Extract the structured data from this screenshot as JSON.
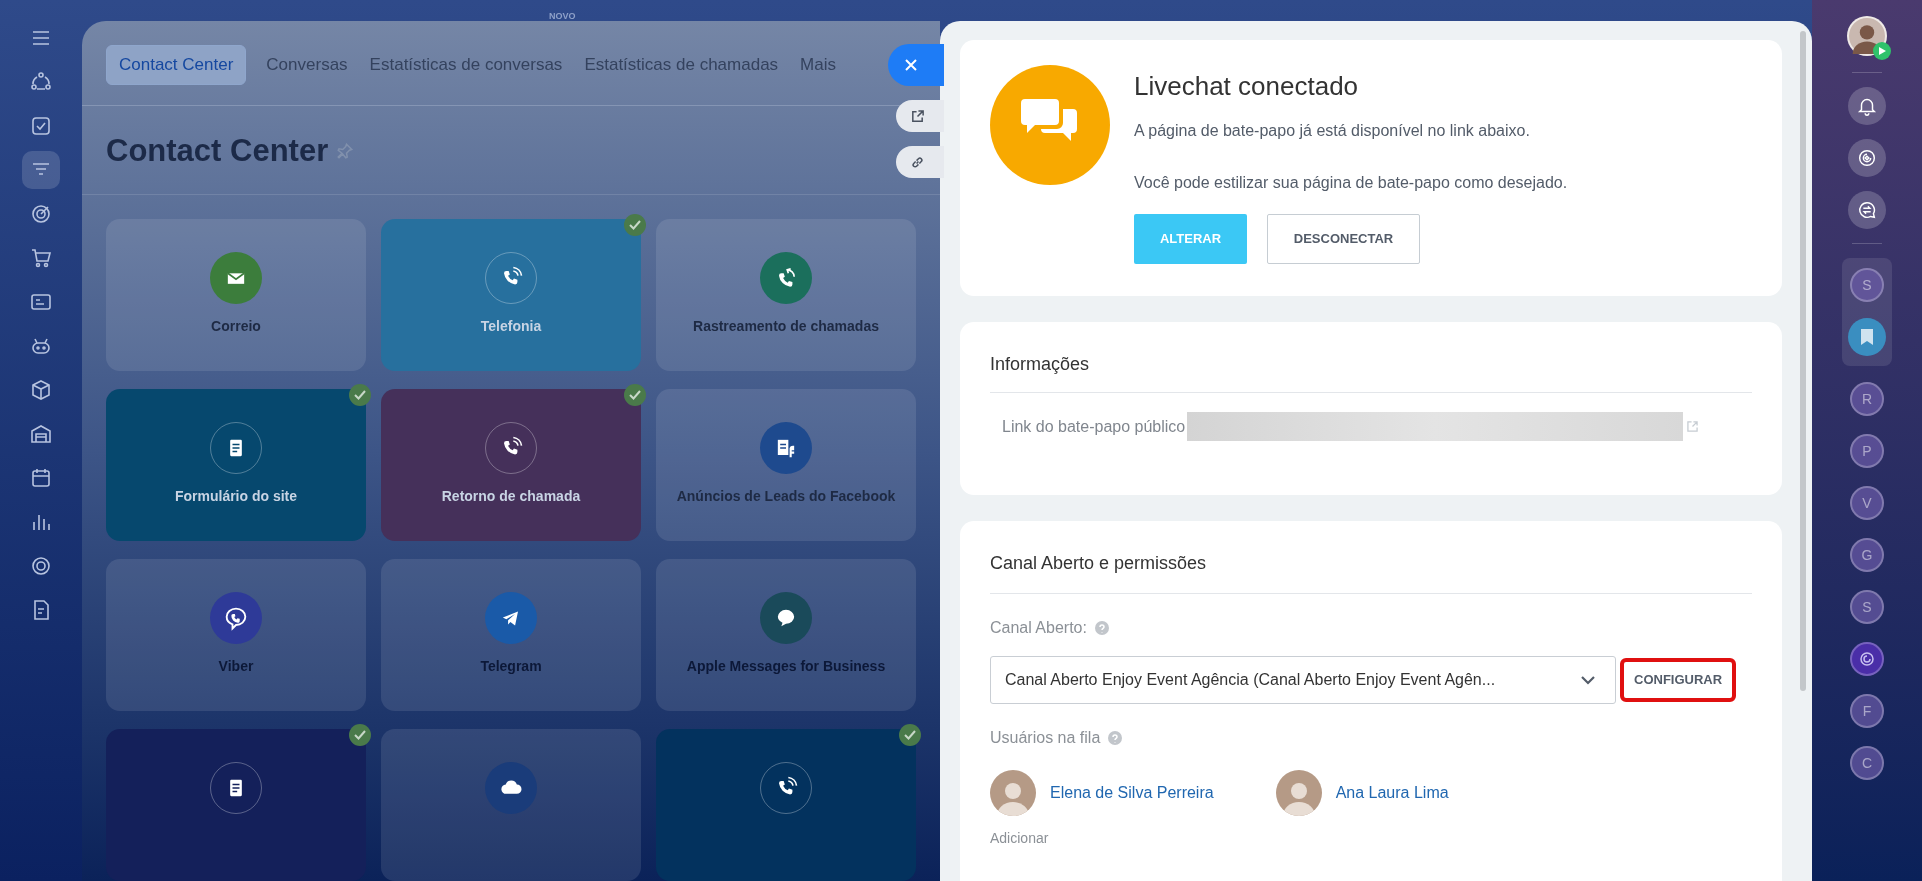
{
  "top_label": "NOVO",
  "page": {
    "tabs": [
      {
        "label": "Contact Center",
        "selected": true
      },
      {
        "label": "Conversas",
        "selected": false
      },
      {
        "label": "Estatísticas de conversas",
        "selected": false
      },
      {
        "label": "Estatísticas de chamadas",
        "selected": false
      },
      {
        "label": "Mais",
        "selected": false
      }
    ],
    "title": "Contact Center",
    "tiles": [
      {
        "label": "Correio",
        "kind": "mail",
        "checked": false,
        "color": "#3c7d3c"
      },
      {
        "label": "Telefonia",
        "kind": "phone",
        "checked": true,
        "color": "#27709e"
      },
      {
        "label": "Rastreamento de chamadas",
        "kind": "tracking",
        "checked": false,
        "color": "#1b6f5c"
      },
      {
        "label": "Formulário do site",
        "kind": "form",
        "checked": true,
        "color": "#06486e"
      },
      {
        "label": "Retorno de chamada",
        "kind": "phone",
        "checked": true,
        "color": "#45305a"
      },
      {
        "label": "Anúncios de Leads do Facebook",
        "kind": "facebook",
        "checked": false,
        "color": "#1e4a8e"
      },
      {
        "label": "Viber",
        "kind": "viber",
        "checked": false,
        "color": "#2e3a98"
      },
      {
        "label": "Telegram",
        "kind": "telegram",
        "checked": false,
        "color": "#1a5aa8"
      },
      {
        "label": "Apple Messages for Business",
        "kind": "bubble",
        "checked": false,
        "color": "#1a4a5a"
      },
      {
        "kind": "form",
        "checked": true,
        "color": "#14205a"
      },
      {
        "kind": "cloud",
        "checked": false,
        "color": "#1a3c7a"
      },
      {
        "kind": "phone",
        "checked": true,
        "color": "#03325e"
      }
    ]
  },
  "panel": {
    "status": {
      "title": "Livechat conectado",
      "lines": [
        "A página de bate-papo já está disponível no link abaixo.",
        "Você pode estilizar sua página de bate-papo como desejado."
      ],
      "buttons": [
        {
          "label": "ALTERAR",
          "kind": "primary"
        },
        {
          "label": "DESCONECTAR",
          "kind": "secondary"
        }
      ]
    },
    "info": {
      "title": "Informações",
      "link_label": "Link do bate-papo público"
    },
    "open_channel": {
      "title": "Canal Aberto e permissões",
      "channel_label": "Canal Aberto:",
      "select_value": "Canal Aberto Enjoy Event Agência (Canal Aberto Enjoy Event Agên...",
      "configure": {
        "label": "CONFIGURAR",
        "highlighted": true
      },
      "queue_label": "Usuários na fila",
      "users": [
        "Elena de Silva Perreira",
        "Ana Laura Lima"
      ],
      "add_label": "Adicionar"
    }
  },
  "right_bar": {
    "pinned": [
      {
        "kind": "letter",
        "letter": "S"
      },
      {
        "kind": "bookmark"
      }
    ],
    "chats": [
      {
        "kind": "letter",
        "letter": "R"
      },
      {
        "kind": "letter",
        "letter": "P"
      },
      {
        "kind": "letter",
        "letter": "V"
      },
      {
        "kind": "letter",
        "letter": "G"
      },
      {
        "kind": "letter",
        "letter": "S"
      },
      {
        "kind": "copilot"
      },
      {
        "kind": "letter",
        "letter": "F"
      },
      {
        "kind": "letter",
        "letter": "C"
      }
    ]
  }
}
